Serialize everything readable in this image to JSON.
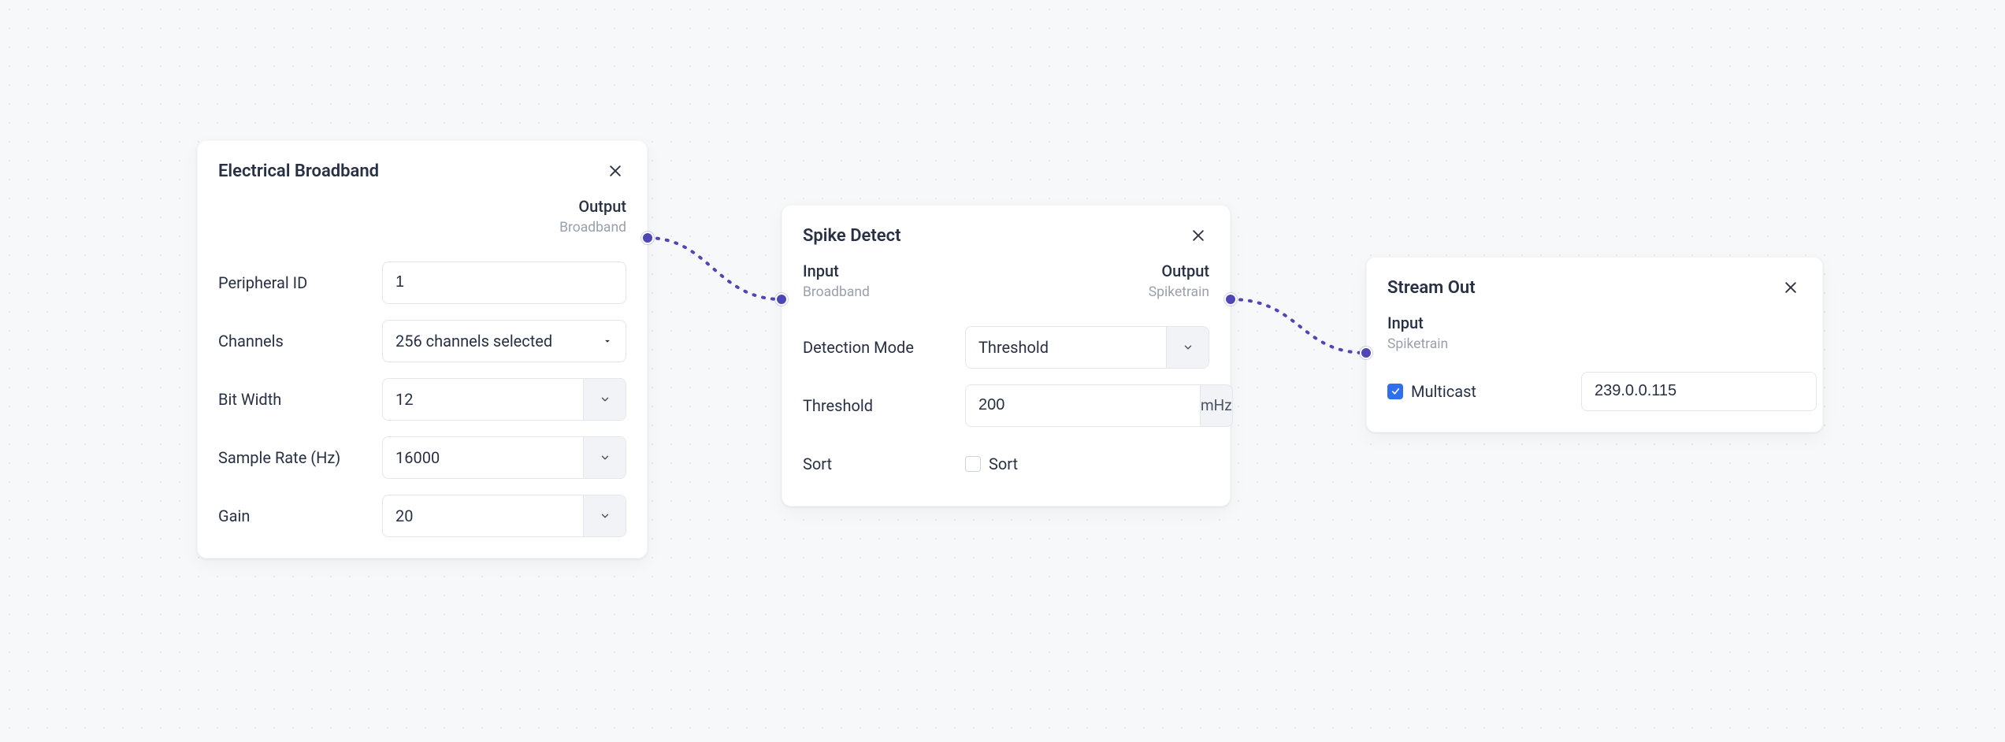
{
  "nodes": {
    "electrical_broadband": {
      "title": "Electrical Broadband",
      "output": {
        "label": "Output",
        "type": "Broadband"
      },
      "fields": {
        "peripheral_id": {
          "label": "Peripheral ID",
          "value": "1"
        },
        "channels": {
          "label": "Channels",
          "value": "256 channels selected"
        },
        "bit_width": {
          "label": "Bit Width",
          "value": "12"
        },
        "sample_rate": {
          "label": "Sample Rate (Hz)",
          "value": "16000"
        },
        "gain": {
          "label": "Gain",
          "value": "20"
        }
      }
    },
    "spike_detect": {
      "title": "Spike Detect",
      "input": {
        "label": "Input",
        "type": "Broadband"
      },
      "output": {
        "label": "Output",
        "type": "Spiketrain"
      },
      "fields": {
        "detection_mode": {
          "label": "Detection Mode",
          "value": "Threshold"
        },
        "threshold": {
          "label": "Threshold",
          "value": "200",
          "unit": "mHz"
        },
        "sort": {
          "label": "Sort",
          "checkbox_label": "Sort",
          "checked": false
        }
      }
    },
    "stream_out": {
      "title": "Stream Out",
      "input": {
        "label": "Input",
        "type": "Spiketrain"
      },
      "fields": {
        "multicast": {
          "label": "Multicast",
          "checked": true,
          "address": "239.0.0.115"
        }
      }
    }
  },
  "connections": [
    {
      "from": "electrical_broadband.output",
      "to": "spike_detect.input"
    },
    {
      "from": "spike_detect.output",
      "to": "stream_out.input"
    }
  ]
}
